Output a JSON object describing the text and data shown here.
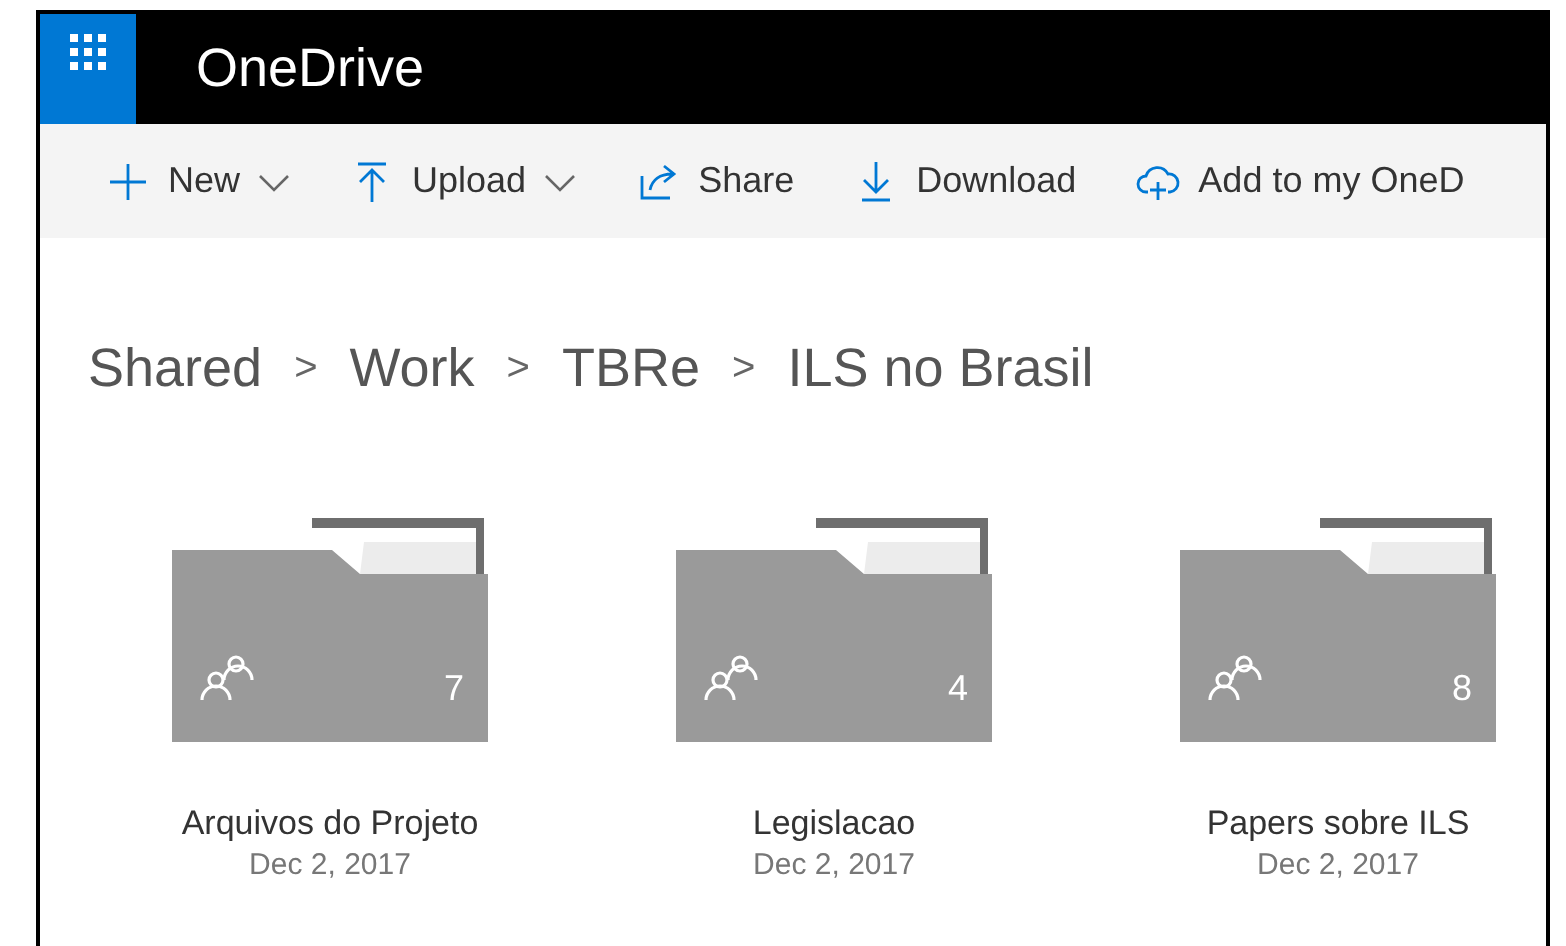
{
  "app": {
    "title": "OneDrive"
  },
  "toolbar": [
    {
      "kind": "new",
      "label": "New",
      "dropdown": true
    },
    {
      "kind": "upload",
      "label": "Upload",
      "dropdown": true
    },
    {
      "kind": "share",
      "label": "Share",
      "dropdown": false
    },
    {
      "kind": "download",
      "label": "Download",
      "dropdown": false
    },
    {
      "kind": "add",
      "label": "Add to my OneD",
      "dropdown": false
    }
  ],
  "breadcrumb": [
    "Shared",
    "Work",
    "TBRe",
    "ILS no Brasil"
  ],
  "separator": ">",
  "folders": [
    {
      "name": "Arquivos do Projeto",
      "date": "Dec 2, 2017",
      "count": "7",
      "shared": true
    },
    {
      "name": "Legislacao",
      "date": "Dec 2, 2017",
      "count": "4",
      "shared": true
    },
    {
      "name": "Papers sobre ILS",
      "date": "Dec 2, 2017",
      "count": "8",
      "shared": true
    }
  ]
}
